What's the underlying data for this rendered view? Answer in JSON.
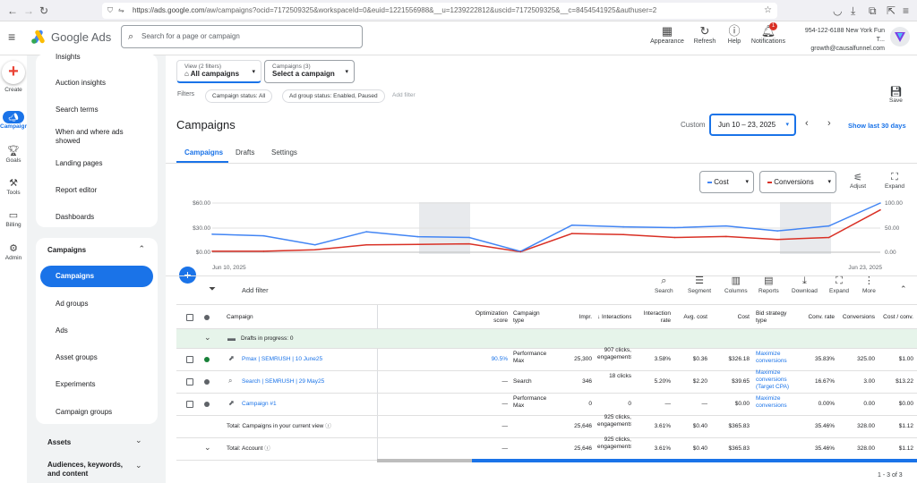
{
  "browser": {
    "url_main": "https://ads.google.com",
    "url_rest": "/aw/campaigns?ocid=7172509325&workspaceId=0&euid=1221556988&__u=1239222812&uscid=7172509325&__c=8454541925&authuser=2"
  },
  "header": {
    "logo_text": "Google Ads",
    "search_placeholder": "Search for a page or campaign",
    "appearance": "Appearance",
    "refresh": "Refresh",
    "help": "Help",
    "notifications": "Notifications",
    "notif_count": "1",
    "account_line1": "954-122-6188 New York Fun T...",
    "account_line2": "growth@causalfunnel.com"
  },
  "rail": {
    "create": "Create",
    "campaigns": "Campaigns",
    "goals": "Goals",
    "tools": "Tools",
    "billing": "Billing",
    "admin": "Admin"
  },
  "sidebar": {
    "top_items": [
      "Insights",
      "Auction insights",
      "Search terms",
      "When and where ads showed",
      "Landing pages",
      "Report editor",
      "Dashboards"
    ],
    "section_title": "Campaigns",
    "section_items": [
      "Campaigns",
      "Ad groups",
      "Ads",
      "Asset groups",
      "Experiments",
      "Campaign groups"
    ],
    "assets": "Assets",
    "audiences": "Audiences, keywords, and content"
  },
  "main": {
    "view_label": "View (2 filters)",
    "view_value": "All campaigns",
    "campaign_label": "Campaigns (3)",
    "campaign_value": "Select a campaign",
    "filters_label": "Filters",
    "chip1": "Campaign status: All",
    "chip2": "Ad group status: Enabled, Paused",
    "add_filter": "Add filter",
    "save": "Save",
    "title": "Campaigns",
    "custom": "Custom",
    "date_range": "Jun 10 – 23, 2025",
    "show_last": "Show last 30 days",
    "tabs": [
      "Campaigns",
      "Drafts",
      "Settings"
    ],
    "metric1": "Cost",
    "metric2": "Conversions",
    "adjust": "Adjust",
    "expand": "Expand",
    "tool_add_filter": "Add filter",
    "tools": [
      "Search",
      "Segment",
      "Columns",
      "Reports",
      "Download",
      "Expand",
      "More"
    ],
    "pagination": "1 - 3 of 3"
  },
  "colors": {
    "accent": "#1a73e8",
    "cost_line": "#4285f4",
    "conv_line": "#d93025",
    "draft_row": "#e6f4ea",
    "enabled": "#188038"
  },
  "chart_data": {
    "type": "line",
    "x": [
      "Jun 10",
      "Jun 11",
      "Jun 12",
      "Jun 13",
      "Jun 14",
      "Jun 15",
      "Jun 16",
      "Jun 17",
      "Jun 18",
      "Jun 19",
      "Jun 20",
      "Jun 21",
      "Jun 22",
      "Jun 23"
    ],
    "x_start_label": "Jun 10, 2025",
    "x_end_label": "Jun 23, 2025",
    "left_ticks": [
      "$60.00",
      "$30.00",
      "$0.00"
    ],
    "right_ticks": [
      "100.00",
      "50.00",
      "0.00"
    ],
    "ylim_left": [
      0,
      60
    ],
    "ylim_right": [
      0,
      100
    ],
    "series": [
      {
        "name": "Cost",
        "axis": "left",
        "values": [
          22,
          20,
          9,
          25,
          19,
          18,
          1,
          33,
          31,
          30,
          32,
          26,
          32,
          60
        ]
      },
      {
        "name": "Conversions",
        "axis": "right",
        "values": [
          2,
          2,
          5,
          15,
          16,
          17,
          1,
          38,
          36,
          30,
          32,
          26,
          30,
          86
        ]
      }
    ]
  },
  "table": {
    "headers": {
      "campaign": "Campaign",
      "opt": "Optimization score",
      "type": "Campaign type",
      "impr": "Impr.",
      "interactions": "↓ Interactions",
      "irate": "Interaction rate",
      "avg": "Avg. cost",
      "cost": "Cost",
      "bid": "Bid strategy type",
      "conv_rate": "Conv. rate",
      "conv": "Conversions",
      "cost_conv": "Cost / conv."
    },
    "draft_row": "Drafts in progress: 0",
    "rows": [
      {
        "name": "Pmax | SEMRUSH | 10 June25",
        "opt": "90.5%",
        "type": "Performance Max",
        "impr": "25,300",
        "inter": "907 clicks, engagements",
        "irate": "3.58%",
        "avg": "$0.36",
        "cost": "$326.18",
        "bid": "Maximize conversions",
        "conv_rate": "35.83%",
        "conv": "325.00",
        "cost_conv": "$1.00"
      },
      {
        "name": "Search | SEMRUSH | 29 May25",
        "opt": "—",
        "type": "Search",
        "impr": "346",
        "inter": "18 clicks",
        "irate": "5.20%",
        "avg": "$2.20",
        "cost": "$39.65",
        "bid": "Maximize conversions (Target CPA)",
        "conv_rate": "16.67%",
        "conv": "3.00",
        "cost_conv": "$13.22"
      },
      {
        "name": "Campaign #1",
        "opt": "—",
        "type": "Performance Max",
        "impr": "0",
        "inter": "0",
        "irate": "—",
        "avg": "—",
        "cost": "$0.00",
        "bid": "Maximize conversions",
        "conv_rate": "0.00%",
        "conv": "0.00",
        "cost_conv": "$0.00"
      }
    ],
    "total1": {
      "label": "Total: Campaigns in your current view",
      "opt": "—",
      "impr": "25,646",
      "inter": "925 clicks, engagements",
      "irate": "3.61%",
      "avg": "$0.40",
      "cost": "$365.83",
      "conv_rate": "35.46%",
      "conv": "328.00",
      "cost_conv": "$1.12"
    },
    "total2": {
      "label": "Total: Account",
      "opt": "—",
      "impr": "25,646",
      "inter": "925 clicks, engagements",
      "irate": "3.61%",
      "avg": "$0.40",
      "cost": "$365.83",
      "conv_rate": "35.46%",
      "conv": "328.00",
      "cost_conv": "$1.12"
    }
  }
}
